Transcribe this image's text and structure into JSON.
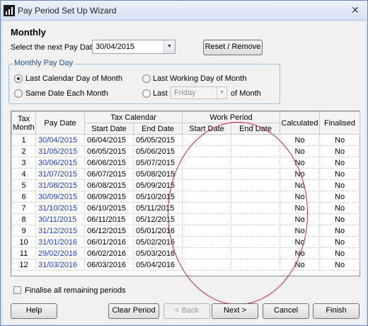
{
  "window": {
    "title": "Pay Period Set Up Wizard",
    "close_glyph": "✕"
  },
  "heading": "Monthly",
  "next_pay_date": {
    "label": "Select the next Pay Date",
    "value": "30/04/2015"
  },
  "buttons": {
    "reset": "Reset / Remove",
    "help": "Help",
    "clear_period": "Clear Period",
    "back": "< Back",
    "next": "Next >",
    "cancel": "Cancel",
    "finish": "Finish"
  },
  "pay_day_group": {
    "label": "Monthly Pay Day",
    "options": {
      "last_calendar_day": "Last Calendar Day of Month",
      "same_date": "Same Date Each Month",
      "last_working_day": "Last Working Day of Month",
      "last": "Last",
      "of_month": "of Month"
    },
    "selected": "last_calendar_day",
    "weekday_value": "Friday"
  },
  "table": {
    "headers": {
      "tax_month": "Tax Month",
      "pay_date": "Pay Date",
      "tax_calendar": "Tax Calendar",
      "work_period": "Work Period",
      "start_date": "Start Date",
      "end_date": "End Date",
      "calculated": "Calculated",
      "finalised": "Finalised"
    },
    "rows": [
      {
        "month": "1",
        "pay_date": "30/04/2015",
        "tax_start": "06/04/2015",
        "tax_end": "05/05/2015",
        "work_start": "",
        "work_end": "",
        "calculated": "No",
        "finalised": "No"
      },
      {
        "month": "2",
        "pay_date": "31/05/2015",
        "tax_start": "06/05/2015",
        "tax_end": "05/06/2015",
        "work_start": "",
        "work_end": "",
        "calculated": "No",
        "finalised": "No"
      },
      {
        "month": "3",
        "pay_date": "30/06/2015",
        "tax_start": "06/06/2015",
        "tax_end": "05/07/2015",
        "work_start": "",
        "work_end": "",
        "calculated": "No",
        "finalised": "No"
      },
      {
        "month": "4",
        "pay_date": "31/07/2015",
        "tax_start": "06/07/2015",
        "tax_end": "05/08/2015",
        "work_start": "",
        "work_end": "",
        "calculated": "No",
        "finalised": "No"
      },
      {
        "month": "5",
        "pay_date": "31/08/2015",
        "tax_start": "06/08/2015",
        "tax_end": "05/09/2015",
        "work_start": "",
        "work_end": "",
        "calculated": "No",
        "finalised": "No"
      },
      {
        "month": "6",
        "pay_date": "30/09/2015",
        "tax_start": "06/09/2015",
        "tax_end": "05/10/2015",
        "work_start": "",
        "work_end": "",
        "calculated": "No",
        "finalised": "No"
      },
      {
        "month": "7",
        "pay_date": "31/10/2015",
        "tax_start": "06/10/2015",
        "tax_end": "05/11/2015",
        "work_start": "",
        "work_end": "",
        "calculated": "No",
        "finalised": "No"
      },
      {
        "month": "8",
        "pay_date": "30/11/2015",
        "tax_start": "06/11/2015",
        "tax_end": "05/12/2015",
        "work_start": "",
        "work_end": "",
        "calculated": "No",
        "finalised": "No"
      },
      {
        "month": "9",
        "pay_date": "31/12/2015",
        "tax_start": "06/12/2015",
        "tax_end": "05/01/2016",
        "work_start": "",
        "work_end": "",
        "calculated": "No",
        "finalised": "No"
      },
      {
        "month": "10",
        "pay_date": "31/01/2016",
        "tax_start": "06/01/2016",
        "tax_end": "05/02/2016",
        "work_start": "",
        "work_end": "",
        "calculated": "No",
        "finalised": "No"
      },
      {
        "month": "11",
        "pay_date": "29/02/2016",
        "tax_start": "06/02/2016",
        "tax_end": "05/03/2016",
        "work_start": "",
        "work_end": "",
        "calculated": "No",
        "finalised": "No"
      },
      {
        "month": "12",
        "pay_date": "31/03/2016",
        "tax_start": "06/03/2016",
        "tax_end": "05/04/2016",
        "work_start": "",
        "work_end": "",
        "calculated": "No",
        "finalised": "No"
      }
    ]
  },
  "finalise_all": {
    "label": "Finalise all remaining periods",
    "checked": false
  },
  "colors": {
    "pay_date_link": "#1a3fc9",
    "annotation_circle": "#c8283c"
  }
}
